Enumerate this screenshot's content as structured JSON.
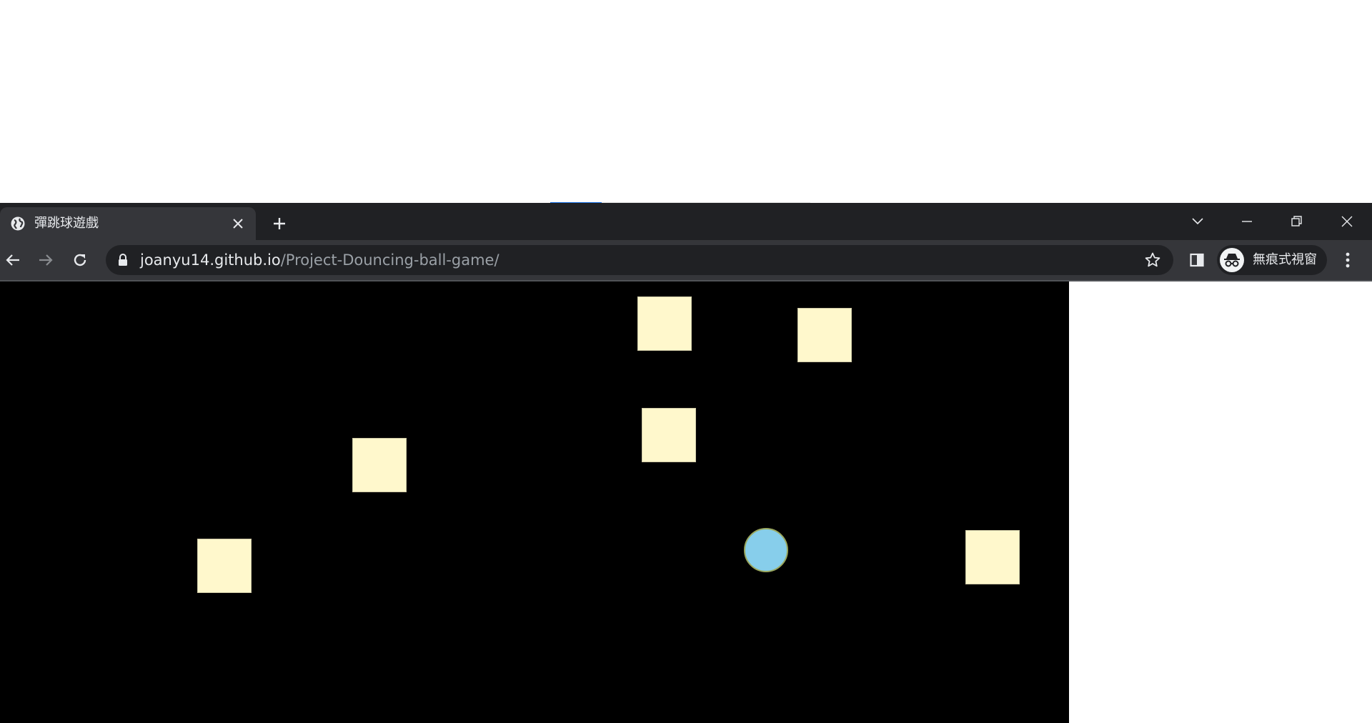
{
  "browser": {
    "tab": {
      "title": "彈跳球遊戲",
      "favicon": "globe-icon",
      "close_icon": "close-icon"
    },
    "new_tab_icon": "plus-icon",
    "window_controls": [
      "tab-search-icon",
      "minimize-icon",
      "restore-icon",
      "close-icon"
    ],
    "nav": {
      "back_icon": "arrow-left-icon",
      "forward_icon": "arrow-right-icon",
      "forward_enabled": false,
      "reload_icon": "reload-icon"
    },
    "address": {
      "lock_icon": "lock-icon",
      "host": "joanyu14.github.io",
      "path": "/Project-Douncing-ball-game/",
      "bookmark_icon": "star-icon"
    },
    "side_panel_icon": "side-panel-icon",
    "profile": {
      "icon": "incognito-icon",
      "label": "無痕式視窗"
    },
    "menu_icon": "kebab-menu-icon"
  },
  "game": {
    "background": "#000000",
    "block_color": "#fff8cc",
    "ball_color": "#87ceeb",
    "ball_outline": "#9aa85f",
    "block_count": 6,
    "ball_count": 1
  },
  "colors": {
    "tabstrip": "#202124",
    "toolbar": "#35363a",
    "omnibox": "#202124",
    "text": "#e8eaed",
    "muted_text": "#9aa0a6",
    "loading_accent": "#1a73e8"
  }
}
